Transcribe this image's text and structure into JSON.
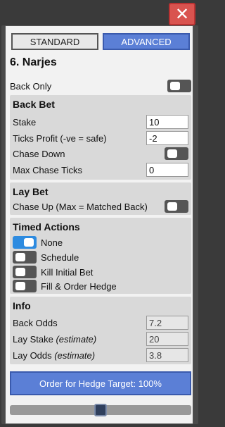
{
  "window": {
    "close_icon": "close-icon"
  },
  "tabs": {
    "standard": "STANDARD",
    "advanced": "ADVANCED"
  },
  "title": "6. Narjes",
  "back_only": {
    "label": "Back Only",
    "on": false
  },
  "back_bet": {
    "title": "Back Bet",
    "stake_label": "Stake",
    "stake_value": "10",
    "ticks_label": "Ticks Profit (-ve = safe)",
    "ticks_value": "-2",
    "chase_down_label": "Chase Down",
    "chase_down_on": false,
    "max_chase_label": "Max Chase Ticks",
    "max_chase_value": "0"
  },
  "lay_bet": {
    "title": "Lay Bet",
    "chase_up_label": "Chase Up (Max = Matched Back)",
    "chase_up_on": false
  },
  "timed_actions": {
    "title": "Timed Actions",
    "options": [
      {
        "label": "None",
        "on": true
      },
      {
        "label": "Schedule",
        "on": false
      },
      {
        "label": "Kill Initial Bet",
        "on": false
      },
      {
        "label": "Fill & Order Hedge",
        "on": false
      }
    ]
  },
  "info": {
    "title": "Info",
    "back_odds_label": "Back Odds",
    "back_odds_value": "7.2",
    "lay_stake_label": "Lay Stake",
    "lay_stake_note": "(estimate)",
    "lay_stake_value": "20",
    "lay_odds_label": "Lay Odds",
    "lay_odds_note": "(estimate)",
    "lay_odds_value": "3.8"
  },
  "order_button": "Order for Hedge Target: 100%",
  "hedge_slider": {
    "value": 0.5
  },
  "colors": {
    "accent": "#5b7fd6",
    "toggle_on": "#2d8be0",
    "close": "#d9534f"
  }
}
